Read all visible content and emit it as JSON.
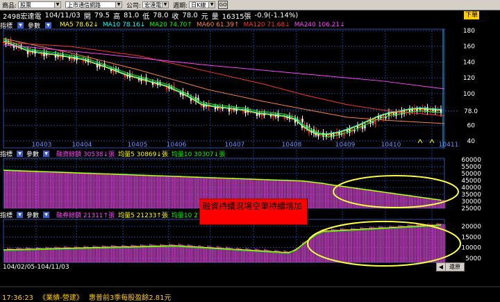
{
  "toolbar": {
    "category_label": "商品:",
    "category_value": "股票",
    "group_value": "上市通信網路",
    "company_label": "公司:",
    "company_value": "宏達電",
    "period_label": "週期:",
    "period_value": "日K線",
    "go_label": "GO"
  },
  "quote": {
    "symbol": "2498宏達電",
    "date": "104/11/03",
    "open_label": "開",
    "open": "79.5",
    "high_label": "高",
    "high": "81.0",
    "low_label": "低",
    "low": "78.0",
    "close_label": "收",
    "close": "78.0",
    "unit_label": "元",
    "volume_label": "量",
    "volume": "16315張",
    "change": "-0.9(-1.14%)",
    "down_label": "下單"
  },
  "ma": {
    "ind_label": "指標",
    "param_label": "參數",
    "items": [
      {
        "text": "MA5 78.62↓",
        "color": "#ffff00"
      },
      {
        "text": "MA10 78.16↓",
        "color": "#00ffff"
      },
      {
        "text": "MA20 74.70↑",
        "color": "#00ff00"
      },
      {
        "text": "MA60 61.39↑",
        "color": "#ff8040"
      },
      {
        "text": "MA120 71.68↓",
        "color": "#ff3030"
      },
      {
        "text": "MA240 106.21↓",
        "color": "#ff40ff"
      }
    ]
  },
  "price_axis": [
    "180",
    "160",
    "140",
    "120",
    "100",
    "80",
    "60",
    "40"
  ],
  "price_current": "78.0",
  "month_labels": [
    "10403",
    "10404",
    "10405",
    "10406",
    "10407",
    "10408",
    "10409",
    "10410",
    "10411"
  ],
  "pane2": {
    "ind_label": "指標",
    "param_label": "參數",
    "items": [
      {
        "text": "融資餘額 30538↓張",
        "color": "#ff40ff"
      },
      {
        "text": "均量5 30869↓張",
        "color": "#ffff00"
      },
      {
        "text": "均量10 30307↓張",
        "color": "#00ff00"
      }
    ],
    "axis": [
      "60000",
      "55000",
      "50000",
      "45000",
      "40000",
      "35000",
      "30000",
      "25000"
    ]
  },
  "pane3": {
    "ind_label": "指標",
    "param_label": "參數",
    "items": [
      {
        "text": "融券餘額 21311↑張",
        "color": "#ff40ff"
      },
      {
        "text": "均量5 21233↑張",
        "color": "#ffff00"
      },
      {
        "text": "均量10 2",
        "color": "#00ff00"
      }
    ],
    "axis": [
      "20000",
      "15000",
      "10000",
      "5000"
    ]
  },
  "annotation": "融資持續退場空單持續增加",
  "date_range": "104/02/05-104/11/03",
  "restore_label": "還原",
  "ticker": {
    "time": "17:36:23",
    "source": "《業績-營建》",
    "headline": "惠普前3季每股盈餘2.81元"
  },
  "colors": {
    "candle_up": "#ff2020",
    "candle_down": "#ffffff",
    "margin_bar": "#c040c0",
    "grid": "#1c3c8c",
    "annotation_ellipse": "#ffff40"
  }
}
